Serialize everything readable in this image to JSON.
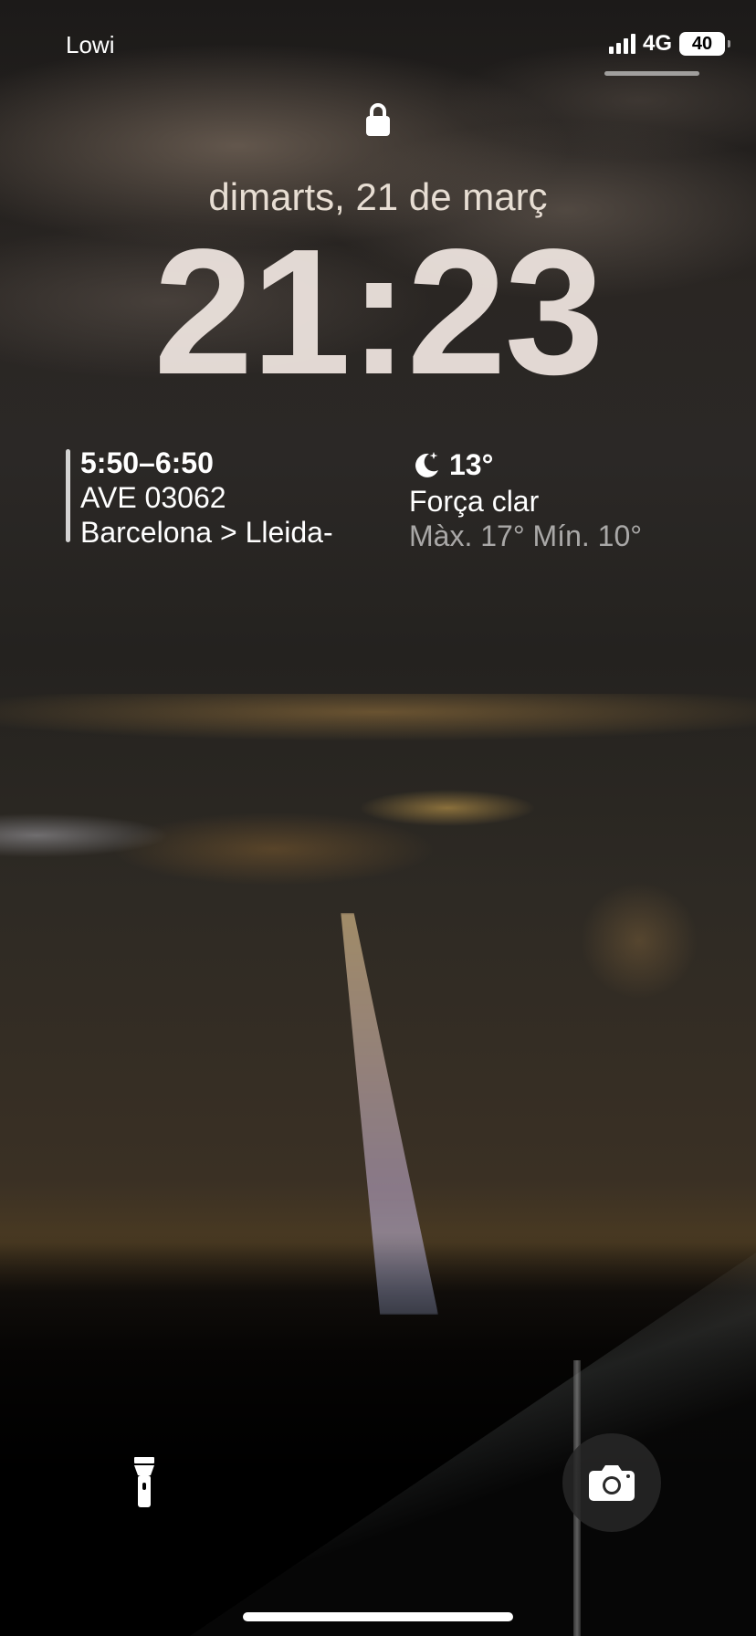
{
  "status_bar": {
    "carrier": "Lowi",
    "network": "4G",
    "battery": "40"
  },
  "lock_screen": {
    "date": "dimarts, 21 de març",
    "time": "21:23"
  },
  "widgets": {
    "event": {
      "time": "5:50–6:50",
      "title": "AVE 03062",
      "route": "Barcelona > Lleida-"
    },
    "weather": {
      "temperature": "13°",
      "condition": "Força clar",
      "range": "Màx. 17° Mín. 10°",
      "icon": "moon-icon"
    }
  },
  "controls": {
    "left_icon": "flashlight-icon",
    "right_icon": "camera-icon"
  }
}
